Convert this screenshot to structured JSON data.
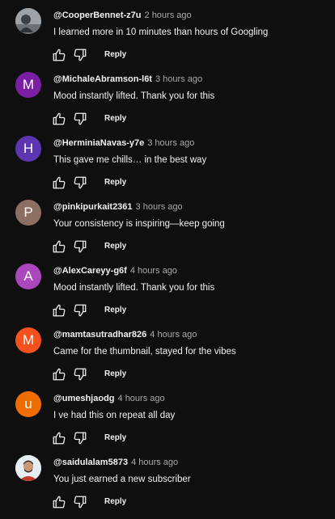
{
  "comments": [
    {
      "handle": "@CooperBennet-z7u",
      "time": "2 hours ago",
      "text": "I learned more in 10 minutes than hours of Googling",
      "avatar_letter": "",
      "avatar_color": "#5b6268",
      "avatar_type": "photo-gray",
      "reply_label": "Reply"
    },
    {
      "handle": "@MichaleAbramson-l6t",
      "time": "3 hours ago",
      "text": "Mood instantly lifted. Thank you for this",
      "avatar_letter": "M",
      "avatar_color": "#7b1fa2",
      "avatar_type": "letter",
      "reply_label": "Reply"
    },
    {
      "handle": "@HerminiaNavas-y7e",
      "time": "3 hours ago",
      "text": "This gave me chills… in the best way",
      "avatar_letter": "H",
      "avatar_color": "#5e35b1",
      "avatar_type": "letter",
      "reply_label": "Reply"
    },
    {
      "handle": "@pinkipurkait2361",
      "time": "3 hours ago",
      "text": "Your consistency is inspiring—keep going",
      "avatar_letter": "P",
      "avatar_color": "#8d6e63",
      "avatar_type": "letter",
      "reply_label": "Reply"
    },
    {
      "handle": "@AlexCareyy-g6f",
      "time": "4 hours ago",
      "text": "Mood instantly lifted. Thank you for this",
      "avatar_letter": "A",
      "avatar_color": "#ab47bc",
      "avatar_type": "letter",
      "reply_label": "Reply"
    },
    {
      "handle": "@mamtasutradhar826",
      "time": "4 hours ago",
      "text": "Came for the thumbnail, stayed for the vibes",
      "avatar_letter": "M",
      "avatar_color": "#f4511e",
      "avatar_type": "letter",
      "reply_label": "Reply"
    },
    {
      "handle": "@umeshjaodg",
      "time": "4 hours ago",
      "text": "I ve had this on repeat all day",
      "avatar_letter": "u",
      "avatar_color": "#ef6c00",
      "avatar_type": "letter",
      "reply_label": "Reply"
    },
    {
      "handle": "@saidulalam5873",
      "time": "4 hours ago",
      "text": "You just earned a new subscriber",
      "avatar_letter": "",
      "avatar_color": "#cfd8dc",
      "avatar_type": "photo-person",
      "reply_label": "Reply"
    }
  ]
}
